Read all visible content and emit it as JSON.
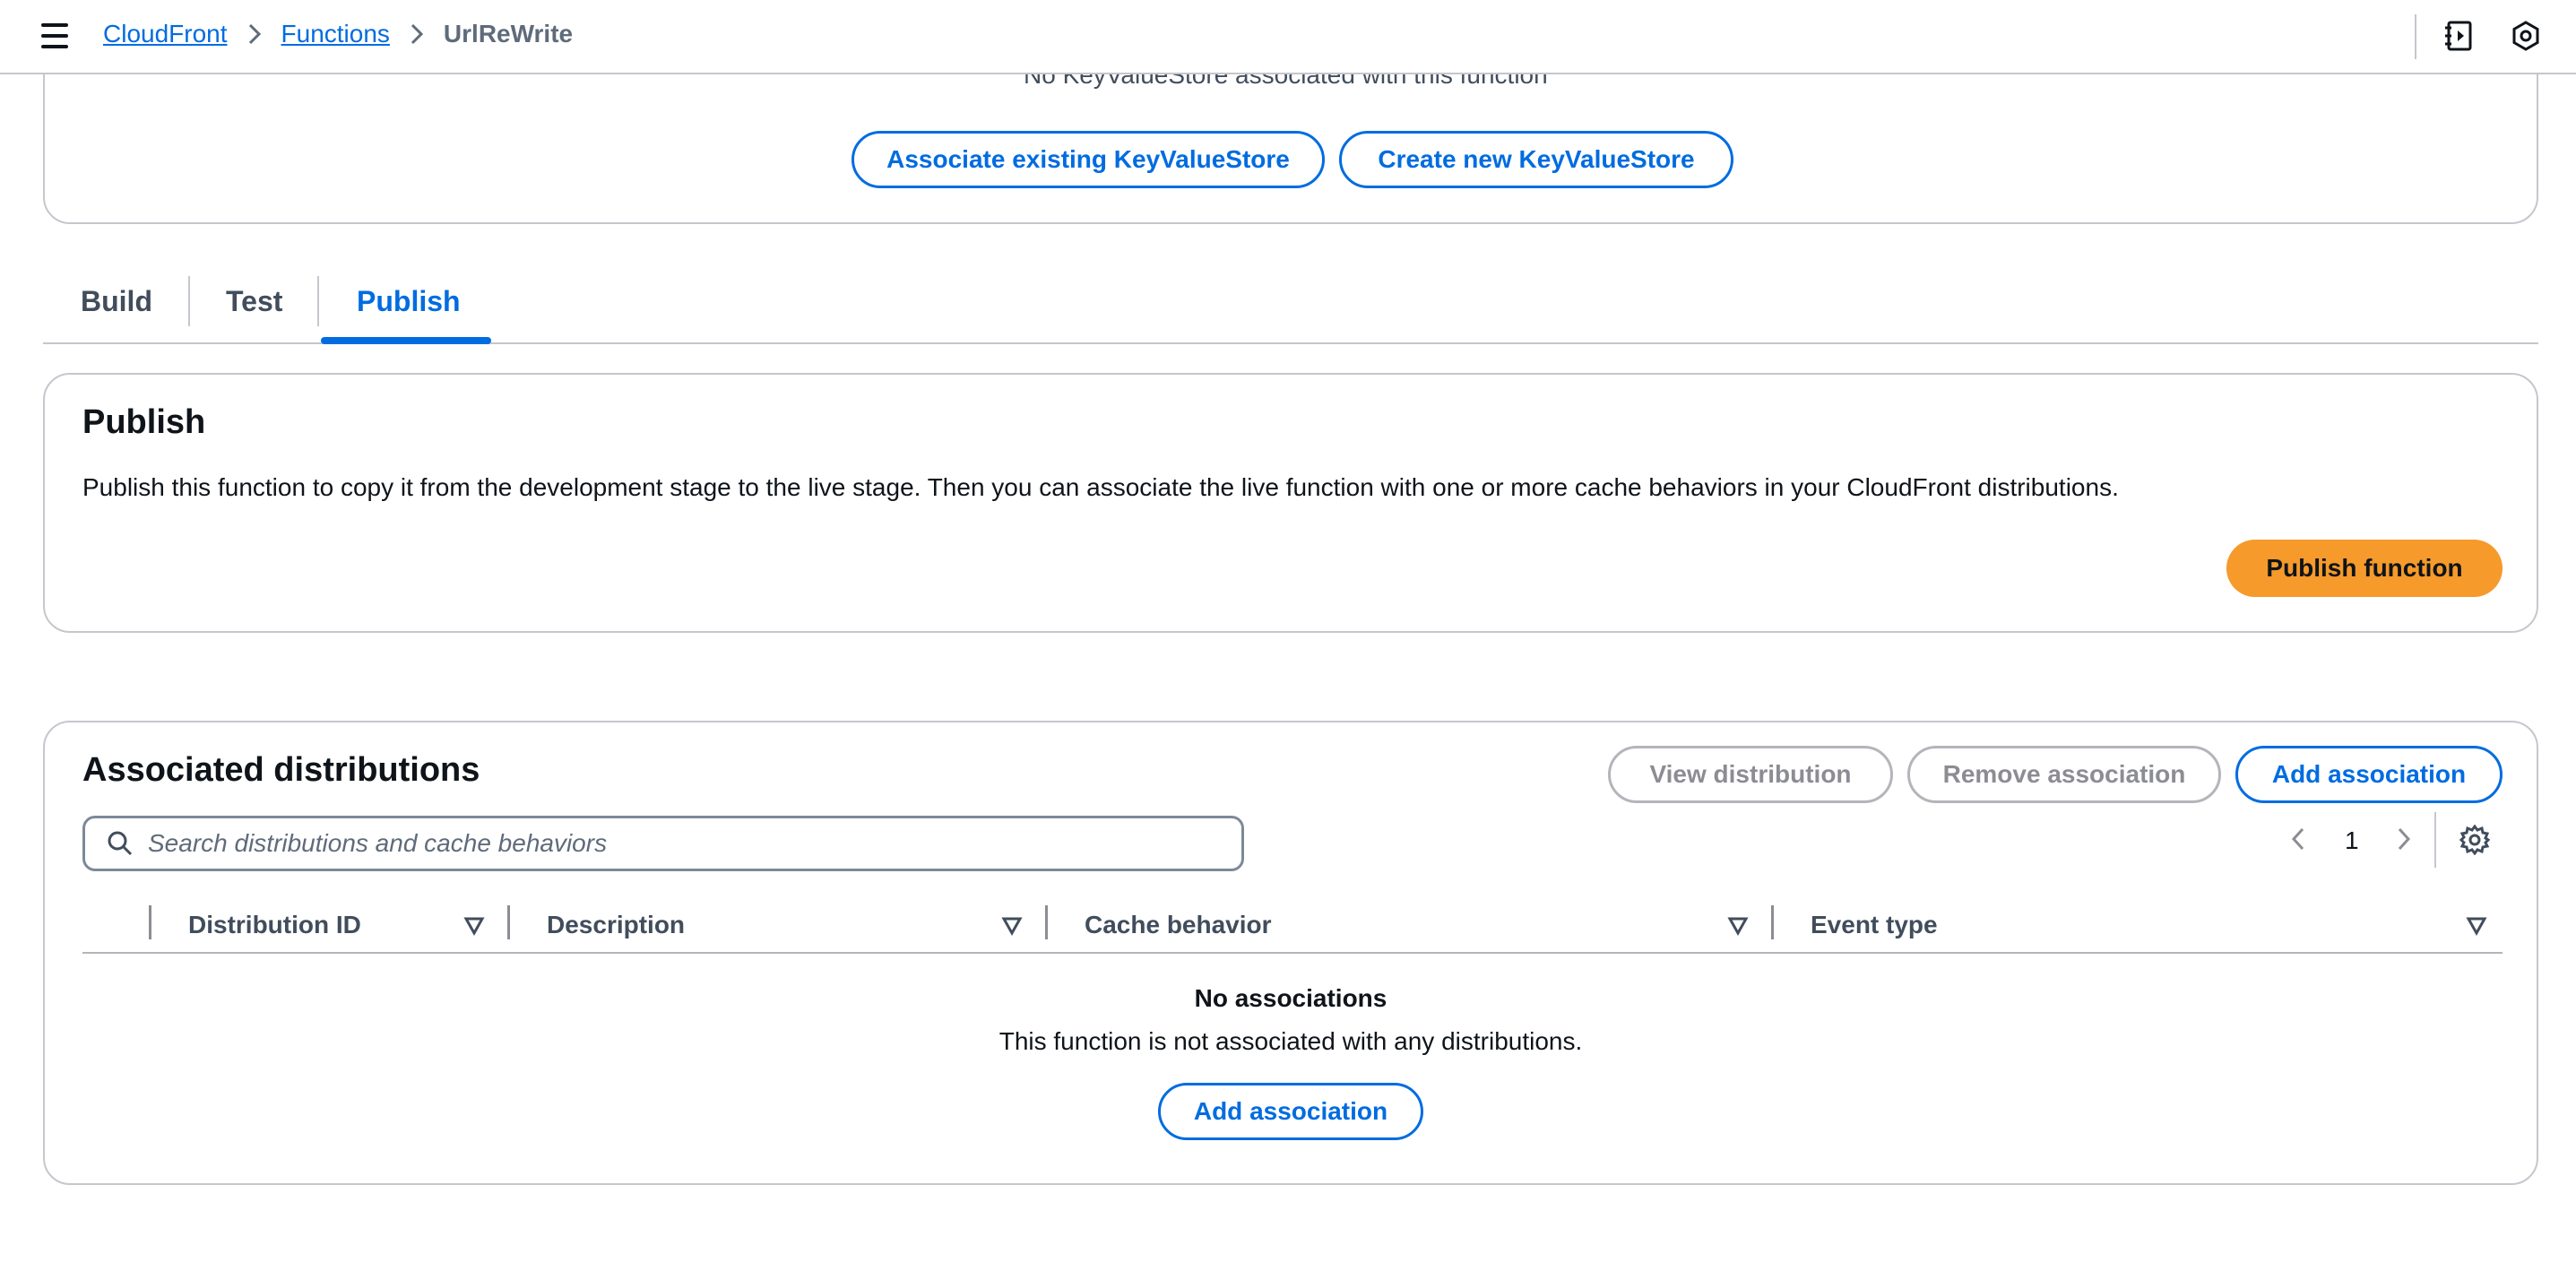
{
  "breadcrumb": {
    "items": [
      "CloudFront",
      "Functions"
    ],
    "current": "UrlReWrite"
  },
  "kvs": {
    "note": "No KeyValueStore associated with this function",
    "associate_label": "Associate existing KeyValueStore",
    "create_label": "Create new KeyValueStore"
  },
  "tabs": [
    {
      "label": "Build",
      "active": false
    },
    {
      "label": "Test",
      "active": false
    },
    {
      "label": "Publish",
      "active": true
    }
  ],
  "publish": {
    "title": "Publish",
    "description": "Publish this function to copy it from the development stage to the live stage. Then you can associate the live function with one or more cache behaviors in your CloudFront distributions.",
    "button_label": "Publish function"
  },
  "distributions": {
    "title": "Associated distributions",
    "view_label": "View distribution",
    "remove_label": "Remove association",
    "add_label": "Add association",
    "search_placeholder": "Search distributions and cache behaviors",
    "page": "1",
    "columns": [
      "Distribution ID",
      "Description",
      "Cache behavior",
      "Event type"
    ],
    "empty_title": "No associations",
    "empty_desc": "This function is not associated with any distributions.",
    "empty_add_label": "Add association"
  },
  "colors": {
    "link": "#006ce0",
    "primary_button": "#f59a2b",
    "border": "#c6c6cd"
  },
  "icons": [
    "menu-icon",
    "chevron-right-icon",
    "notes-icon",
    "settings-hex-icon",
    "search-icon",
    "chevron-left-icon",
    "gear-icon",
    "sort-down-icon"
  ]
}
